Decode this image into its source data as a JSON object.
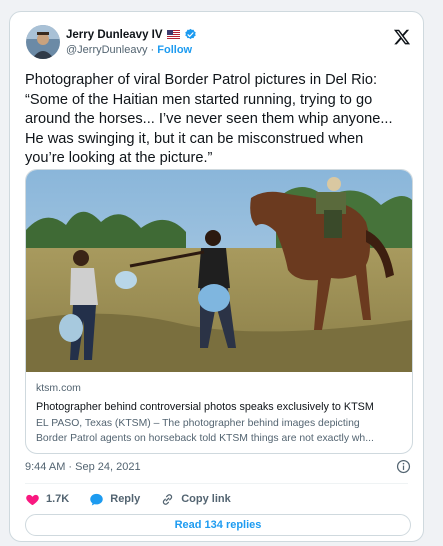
{
  "author": {
    "name": "Jerry Dunleavy IV",
    "handle": "@JerryDunleavy",
    "separator": "·",
    "follow_label": "Follow"
  },
  "tweet": {
    "text_lines": [
      "Photographer of viral Border Patrol pictures in Del Rio:",
      "“Some of the Haitian men started running, trying to go",
      "around the horses... I’ve never seen them whip anyone...",
      "He was swinging it, but it can be misconstrued when",
      "you’re looking at the picture.”"
    ]
  },
  "link_card": {
    "domain": "ktsm.com",
    "title": "Photographer behind controversial photos speaks exclusively to KTSM",
    "description_lines": [
      "EL PASO, Texas (KTSM) – The photographer behind images depicting",
      "Border Patrol agents on horseback told KTSM things are not exactly wh..."
    ]
  },
  "timestamp": "9:44 AM · Sep 24, 2021",
  "actions": {
    "like_count": "1.7K",
    "reply_label": "Reply",
    "copy_link_label": "Copy link"
  },
  "read_replies_label": "Read 134 replies",
  "icons": {
    "like": "heart-icon",
    "reply": "speech-bubble-icon",
    "copy_link": "link-icon",
    "info": "info-icon",
    "brand": "x-logo-icon",
    "verified": "verified-badge-icon",
    "flag": "us-flag-icon"
  },
  "colors": {
    "like": "#f91880",
    "reply": "#1d9bf0",
    "follow": "#1d9bf0",
    "verified": "#1d9bf0",
    "secondary_text": "#536471",
    "border": "#cfd9de"
  }
}
